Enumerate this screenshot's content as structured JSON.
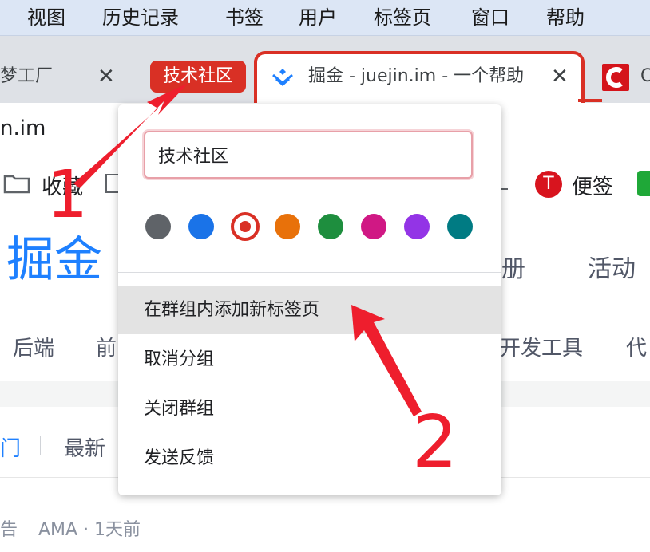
{
  "menubar": {
    "items": [
      "视图",
      "历史记录",
      "书签",
      "用户",
      "标签页",
      "窗口",
      "帮助"
    ]
  },
  "tabs": {
    "left_tab_title": "梦工厂",
    "group_name": "技术社区",
    "active_tab_title": "掘金 - juejin.im - 一个帮助",
    "right_tab_title": "C",
    "close_glyph": "✕"
  },
  "address": {
    "url_fragment": "n.im"
  },
  "bookmarks": {
    "items": [
      "收藏",
      "便签"
    ],
    "bianqian_badge": "T"
  },
  "page": {
    "logo": "掘金",
    "nav_right": [
      "册",
      "活动"
    ],
    "categories": [
      "后端",
      "前",
      "开发工具",
      "代"
    ],
    "feed_tabs": [
      "门",
      "最新"
    ],
    "footer_meta": [
      "告",
      "AMA · 1天前"
    ]
  },
  "group_popup": {
    "name_value": "技术社区",
    "colors": [
      "#5f6368",
      "#1a73e8",
      "#d93025",
      "#e8710a",
      "#1e8e3e",
      "#d01884",
      "#9334e6",
      "#007b83"
    ],
    "selected_color": "#d93025",
    "menu": [
      "在群组内添加新标签页",
      "取消分组",
      "关闭群组",
      "发送反馈"
    ]
  },
  "annotations": {
    "label_1": "1",
    "label_2": "2",
    "arrow_color": "#ee1e2d"
  }
}
